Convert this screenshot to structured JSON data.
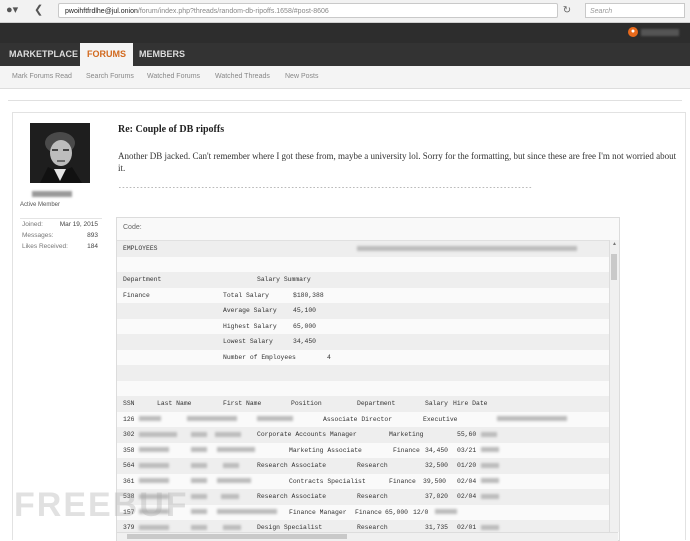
{
  "browser": {
    "url_host": "pwoihftfrdlhe@jul.onion",
    "url_path": "/forum/index.php?threads/random-db-ripoffs.1658/#post-8606",
    "search_placeholder": "Search"
  },
  "nav": {
    "tabs": [
      {
        "label": "MARKETPLACE",
        "active": false
      },
      {
        "label": "FORUMS",
        "active": true
      },
      {
        "label": "MEMBERS",
        "active": false
      }
    ],
    "sublinks": [
      "Mark Forums Read",
      "Search Forums",
      "Watched Forums",
      "Watched Threads",
      "New Posts"
    ]
  },
  "user": {
    "title": "Active Member",
    "stats": [
      {
        "key": "Joined:",
        "value": "Mar 19, 2015"
      },
      {
        "key": "Messages:",
        "value": "893"
      },
      {
        "key": "Likes Received:",
        "value": "184"
      }
    ]
  },
  "post": {
    "title": "Re: Couple of DB ripoffs",
    "body": "Another DB jacked. Can't remember where I got these from, maybe a university lol. Sorry for the formatting, but since these are free I'm not worried about it.",
    "separator": "-------------------------------------------------------------------------------------------------------------------"
  },
  "code": {
    "label": "Code:",
    "header": "EMPLOYEES",
    "summary_heading": [
      "Department",
      "Salary Summary"
    ],
    "summary_dept": "Finance",
    "summary_rows": [
      {
        "k": "Total Salary",
        "v": "$180,388"
      },
      {
        "k": "Average Salary",
        "v": "45,100"
      },
      {
        "k": "Highest Salary",
        "v": "65,000"
      },
      {
        "k": "Lowest Salary",
        "v": "34,450"
      },
      {
        "k": "Number of Employees",
        "v": "4"
      }
    ],
    "table_headers": [
      "SSN",
      "Last Name",
      "First Name",
      "Position",
      "Department",
      "Salary",
      "Hire Date"
    ],
    "rows": [
      {
        "ssn": "126",
        "position": "Associate Director",
        "dept": "Executive",
        "salary": "",
        "hire": ""
      },
      {
        "ssn": "302",
        "position": "Corporate Accounts Manager",
        "dept": "Marketing",
        "salary": "55,60",
        "hire": ""
      },
      {
        "ssn": "358",
        "position": "Marketing Associate",
        "dept": "Finance",
        "salary": "34,450",
        "hire": "03/21"
      },
      {
        "ssn": "564",
        "position": "Research Associate",
        "dept": "Research",
        "salary": "32,500",
        "hire": "01/20"
      },
      {
        "ssn": "361",
        "position": "Contracts Specialist",
        "dept": "Finance",
        "salary": "39,500",
        "hire": "02/04"
      },
      {
        "ssn": "538",
        "position": "Research Associate",
        "dept": "Research",
        "salary": "37,020",
        "hire": "02/04"
      },
      {
        "ssn": "157",
        "position": "Finance Manager",
        "dept": "Finance",
        "salary": "65,000",
        "hire": "12/0"
      },
      {
        "ssn": "379",
        "position": "Design Specialist",
        "dept": "Research",
        "salary": "31,735",
        "hire": "02/01"
      }
    ]
  }
}
